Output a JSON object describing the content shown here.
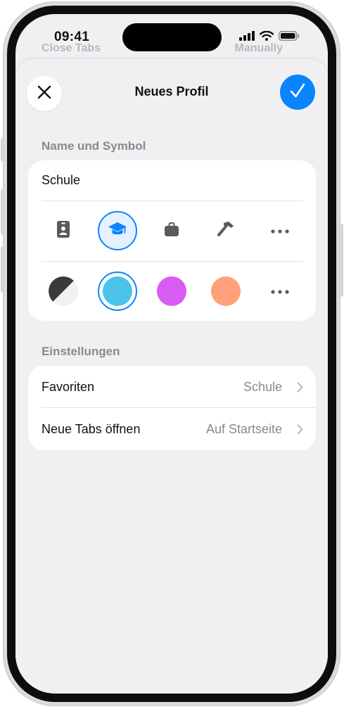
{
  "status_bar": {
    "time": "09:41",
    "icons": [
      "signal-icon",
      "wifi-icon",
      "battery-icon"
    ]
  },
  "background": {
    "left_text": "Close Tabs",
    "right_text": "Manually"
  },
  "sheet": {
    "title": "Neues Profil",
    "close_icon": "xmark-icon",
    "done_icon": "checkmark-icon"
  },
  "name_section": {
    "header": "Name und Symbol",
    "name_value": "Schule",
    "icons": [
      "person-badge-icon",
      "graduation-cap-icon",
      "briefcase-icon",
      "hammer-icon",
      "more-icon"
    ],
    "selected_icon": "graduation-cap-icon",
    "colors": [
      "#3a3a3c",
      "#4cc3ea",
      "#d65cf4",
      "#ffa07a"
    ],
    "selected_color": "#4cc3ea",
    "more_colors_icon": "more-icon"
  },
  "settings_section": {
    "header": "Einstellungen",
    "rows": [
      {
        "label": "Favoriten",
        "value": "Schule"
      },
      {
        "label": "Neue Tabs öffnen",
        "value": "Auf Startseite"
      }
    ]
  },
  "colors": {
    "accent": "#0a84ff",
    "background": "#f0f0f3",
    "secondary_text": "#8a8a8e"
  }
}
